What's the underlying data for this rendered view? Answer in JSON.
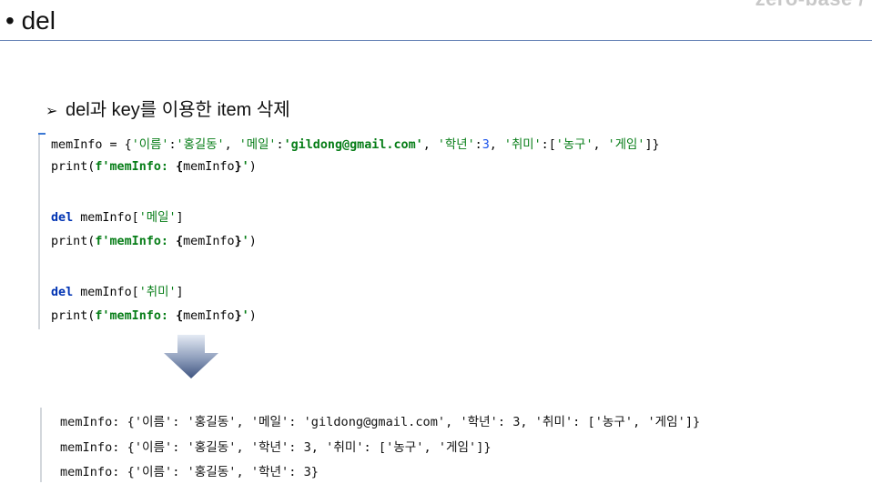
{
  "brand": "zero-base /",
  "slide_title": "• del",
  "section_heading": {
    "bullet": "➢",
    "text": "del과 key를 이용한 item 삭제"
  },
  "code": {
    "line1": {
      "a": "memInfo = {",
      "k1": "'이름'",
      "c1": ":",
      "v1": "'홍길동'",
      "c2": ", ",
      "k2": "'메일'",
      "c3": ":",
      "v2": "'gildong@gmail.com'",
      "c4": ", ",
      "k3": "'학년'",
      "c5": ":",
      "v3": "3",
      "c6": ", ",
      "k4": "'취미'",
      "c7": ":[",
      "v4": "'농구'",
      "c8": ", ",
      "v5": "'게임'",
      "c9": "]}"
    },
    "print_line": {
      "fn": "print(",
      "fstr": "f'memInfo: ",
      "ob": "{",
      "var": "memInfo",
      "cb": "}",
      "q": "'",
      "close": ")"
    },
    "del1": {
      "kw": "del",
      "mid": " memInfo[",
      "key": "'메일'",
      "end": "]"
    },
    "del2": {
      "kw": "del",
      "mid": " memInfo[",
      "key": "'취미'",
      "end": "]"
    }
  },
  "output": {
    "line1": "memInfo: {'이름': '홍길동', '메일': 'gildong@gmail.com', '학년': 3, '취미': ['농구', '게임']}",
    "line2": "memInfo: {'이름': '홍길동', '학년': 3, '취미': ['농구', '게임']}",
    "line3": "memInfo: {'이름': '홍길동', '학년': 3}"
  },
  "colors": {
    "keyword": "#0033b3",
    "string": "#067d17",
    "number": "#1750eb",
    "title_rule": "#6b86b8",
    "arrow_top": "#dfe6f2",
    "arrow_bottom": "#4a5f88"
  },
  "icons": {
    "arrow": "down-arrow-icon"
  }
}
